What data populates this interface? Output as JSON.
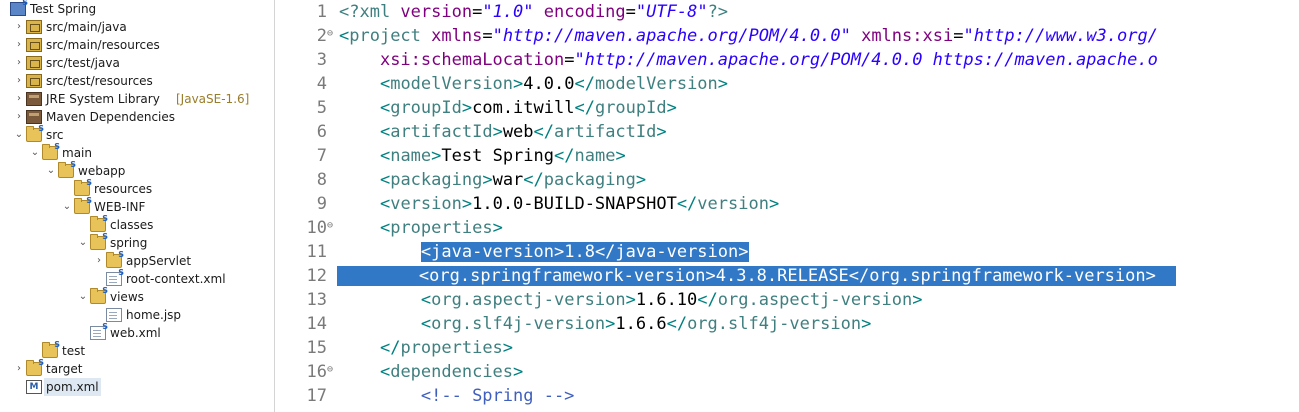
{
  "explorer": {
    "rows": [
      {
        "twisty": "",
        "icon": "project-icon",
        "label": "Test Spring",
        "decoration": "",
        "indent": 0
      },
      {
        "twisty": ">",
        "icon": "package-folder-icon",
        "label": "src/main/java",
        "decoration": "",
        "indent": 1
      },
      {
        "twisty": ">",
        "icon": "package-folder-icon",
        "label": "src/main/resources",
        "decoration": "",
        "indent": 1
      },
      {
        "twisty": ">",
        "icon": "package-folder-icon",
        "label": "src/test/java",
        "decoration": "",
        "indent": 1
      },
      {
        "twisty": ">",
        "icon": "package-folder-icon",
        "label": "src/test/resources",
        "decoration": "",
        "indent": 1
      },
      {
        "twisty": ">",
        "icon": "library-icon",
        "label": "JRE System Library",
        "decoration": "[JavaSE-1.6]",
        "indent": 1
      },
      {
        "twisty": ">",
        "icon": "library-icon",
        "label": "Maven Dependencies",
        "decoration": "",
        "indent": 1
      },
      {
        "twisty": "v",
        "icon": "folder-icon",
        "label": "src",
        "decoration": "",
        "indent": 1
      },
      {
        "twisty": "v",
        "icon": "folder-icon",
        "label": "main",
        "decoration": "",
        "indent": 2
      },
      {
        "twisty": "v",
        "icon": "folder-icon",
        "label": "webapp",
        "decoration": "",
        "indent": 3
      },
      {
        "twisty": "",
        "icon": "folder-icon",
        "label": "resources",
        "decoration": "",
        "indent": 4
      },
      {
        "twisty": "v",
        "icon": "folder-icon",
        "label": "WEB-INF",
        "decoration": "",
        "indent": 4
      },
      {
        "twisty": "",
        "icon": "folder-icon",
        "label": "classes",
        "decoration": "",
        "indent": 5
      },
      {
        "twisty": "v",
        "icon": "folder-icon",
        "label": "spring",
        "decoration": "",
        "indent": 5
      },
      {
        "twisty": ">",
        "icon": "folder-icon",
        "label": "appServlet",
        "decoration": "",
        "indent": 6
      },
      {
        "twisty": "",
        "icon": "xml-file-icon",
        "label": "root-context.xml",
        "decoration": "",
        "indent": 6
      },
      {
        "twisty": "v",
        "icon": "folder-icon",
        "label": "views",
        "decoration": "",
        "indent": 5
      },
      {
        "twisty": "",
        "icon": "file-icon",
        "label": "home.jsp",
        "decoration": "",
        "indent": 6
      },
      {
        "twisty": "",
        "icon": "xml-file-icon",
        "label": "web.xml",
        "decoration": "",
        "indent": 5
      },
      {
        "twisty": "",
        "icon": "folder-icon",
        "label": "test",
        "decoration": "",
        "indent": 2
      },
      {
        "twisty": ">",
        "icon": "folder-icon",
        "label": "target",
        "decoration": "",
        "indent": 1
      },
      {
        "twisty": "",
        "icon": "maven-pom-icon",
        "label": "pom.xml",
        "decoration": "",
        "indent": 1
      }
    ],
    "selected_label": "pom.xml"
  },
  "editor": {
    "filename": "pom.xml",
    "lines": [
      {
        "n": "1",
        "fold": "",
        "sel": false,
        "segs": [
          [
            "pi",
            "<?xml "
          ],
          [
            "attr",
            "version"
          ],
          [
            "txt",
            "="
          ],
          [
            "str",
            "\"1.0\""
          ],
          [
            "txt",
            " "
          ],
          [
            "attr",
            "encoding"
          ],
          [
            "txt",
            "="
          ],
          [
            "str",
            "\"UTF-8\""
          ],
          [
            "pi",
            "?>"
          ]
        ]
      },
      {
        "n": "2",
        "fold": "⊖",
        "sel": false,
        "segs": [
          [
            "bracket",
            "<"
          ],
          [
            "tag",
            "project"
          ],
          [
            "txt",
            " "
          ],
          [
            "attr",
            "xmlns"
          ],
          [
            "txt",
            "="
          ],
          [
            "str",
            "\"http://maven.apache.org/POM/4.0.0\""
          ],
          [
            "txt",
            " "
          ],
          [
            "attr",
            "xmlns:xsi"
          ],
          [
            "txt",
            "="
          ],
          [
            "str",
            "\"http://www.w3.org/"
          ]
        ]
      },
      {
        "n": "3",
        "fold": "",
        "sel": false,
        "segs": [
          [
            "txt",
            "    "
          ],
          [
            "attr",
            "xsi:schemaLocation"
          ],
          [
            "txt",
            "="
          ],
          [
            "str",
            "\"http://maven.apache.org/POM/4.0.0 https://maven.apache.o"
          ]
        ]
      },
      {
        "n": "4",
        "fold": "",
        "sel": false,
        "segs": [
          [
            "txt",
            "    "
          ],
          [
            "bracket",
            "<"
          ],
          [
            "tag",
            "modelVersion"
          ],
          [
            "bracket",
            ">"
          ],
          [
            "txt",
            "4.0.0"
          ],
          [
            "bracket",
            "</"
          ],
          [
            "tag",
            "modelVersion"
          ],
          [
            "bracket",
            ">"
          ]
        ]
      },
      {
        "n": "5",
        "fold": "",
        "sel": false,
        "segs": [
          [
            "txt",
            "    "
          ],
          [
            "bracket",
            "<"
          ],
          [
            "tag",
            "groupId"
          ],
          [
            "bracket",
            ">"
          ],
          [
            "txt",
            "com.itwill"
          ],
          [
            "bracket",
            "</"
          ],
          [
            "tag",
            "groupId"
          ],
          [
            "bracket",
            ">"
          ]
        ]
      },
      {
        "n": "6",
        "fold": "",
        "sel": false,
        "segs": [
          [
            "txt",
            "    "
          ],
          [
            "bracket",
            "<"
          ],
          [
            "tag",
            "artifactId"
          ],
          [
            "bracket",
            ">"
          ],
          [
            "txt",
            "web"
          ],
          [
            "bracket",
            "</"
          ],
          [
            "tag",
            "artifactId"
          ],
          [
            "bracket",
            ">"
          ]
        ]
      },
      {
        "n": "7",
        "fold": "",
        "sel": false,
        "segs": [
          [
            "txt",
            "    "
          ],
          [
            "bracket",
            "<"
          ],
          [
            "tag",
            "name"
          ],
          [
            "bracket",
            ">"
          ],
          [
            "txt",
            "Test Spring"
          ],
          [
            "bracket",
            "</"
          ],
          [
            "tag",
            "name"
          ],
          [
            "bracket",
            ">"
          ]
        ]
      },
      {
        "n": "8",
        "fold": "",
        "sel": false,
        "segs": [
          [
            "txt",
            "    "
          ],
          [
            "bracket",
            "<"
          ],
          [
            "tag",
            "packaging"
          ],
          [
            "bracket",
            ">"
          ],
          [
            "txt",
            "war"
          ],
          [
            "bracket",
            "</"
          ],
          [
            "tag",
            "packaging"
          ],
          [
            "bracket",
            ">"
          ]
        ]
      },
      {
        "n": "9",
        "fold": "",
        "sel": false,
        "segs": [
          [
            "txt",
            "    "
          ],
          [
            "bracket",
            "<"
          ],
          [
            "tag",
            "version"
          ],
          [
            "bracket",
            ">"
          ],
          [
            "txt",
            "1.0.0-BUILD-SNAPSHOT"
          ],
          [
            "bracket",
            "</"
          ],
          [
            "tag",
            "version"
          ],
          [
            "bracket",
            ">"
          ]
        ]
      },
      {
        "n": "10",
        "fold": "⊖",
        "sel": false,
        "segs": [
          [
            "txt",
            "    "
          ],
          [
            "bracket",
            "<"
          ],
          [
            "tag",
            "properties"
          ],
          [
            "bracket",
            ">"
          ]
        ]
      },
      {
        "n": "11",
        "fold": "",
        "sel": true,
        "segs": [
          [
            "txt",
            "        "
          ],
          [
            "bracket",
            "<"
          ],
          [
            "tag",
            "java-version"
          ],
          [
            "bracket",
            ">"
          ],
          [
            "txt",
            "1.8"
          ],
          [
            "bracket",
            "</"
          ],
          [
            "tag",
            "java-version"
          ],
          [
            "bracket",
            ">"
          ]
        ]
      },
      {
        "n": "12",
        "fold": "",
        "sel": true,
        "segs": [
          [
            "txt",
            "        "
          ],
          [
            "bracket",
            "<"
          ],
          [
            "tag",
            "org.springframework-version"
          ],
          [
            "bracket",
            ">"
          ],
          [
            "txt",
            "4.3.8.RELEASE"
          ],
          [
            "bracket",
            "</"
          ],
          [
            "tag",
            "org.springframework-version"
          ],
          [
            "bracket",
            ">"
          ]
        ]
      },
      {
        "n": "13",
        "fold": "",
        "sel": false,
        "segs": [
          [
            "txt",
            "        "
          ],
          [
            "bracket",
            "<"
          ],
          [
            "tag",
            "org.aspectj-version"
          ],
          [
            "bracket",
            ">"
          ],
          [
            "txt",
            "1.6.10"
          ],
          [
            "bracket",
            "</"
          ],
          [
            "tag",
            "org.aspectj-version"
          ],
          [
            "bracket",
            ">"
          ]
        ]
      },
      {
        "n": "14",
        "fold": "",
        "sel": false,
        "segs": [
          [
            "txt",
            "        "
          ],
          [
            "bracket",
            "<"
          ],
          [
            "tag",
            "org.slf4j-version"
          ],
          [
            "bracket",
            ">"
          ],
          [
            "txt",
            "1.6.6"
          ],
          [
            "bracket",
            "</"
          ],
          [
            "tag",
            "org.slf4j-version"
          ],
          [
            "bracket",
            ">"
          ]
        ]
      },
      {
        "n": "15",
        "fold": "",
        "sel": false,
        "segs": [
          [
            "txt",
            "    "
          ],
          [
            "bracket",
            "</"
          ],
          [
            "tag",
            "properties"
          ],
          [
            "bracket",
            ">"
          ]
        ]
      },
      {
        "n": "16",
        "fold": "⊖",
        "sel": false,
        "segs": [
          [
            "txt",
            "    "
          ],
          [
            "bracket",
            "<"
          ],
          [
            "tag",
            "dependencies"
          ],
          [
            "bracket",
            ">"
          ]
        ]
      },
      {
        "n": "17",
        "fold": "",
        "sel": false,
        "segs": [
          [
            "txt",
            "        "
          ],
          [
            "cmt",
            "<!-- Spring -->"
          ]
        ]
      }
    ],
    "colors": {
      "selection": "#3178c6",
      "tag": "#3f7f7f",
      "attr": "#7f007f",
      "string": "#2a00ff",
      "comment": "#3f5fbf"
    }
  }
}
